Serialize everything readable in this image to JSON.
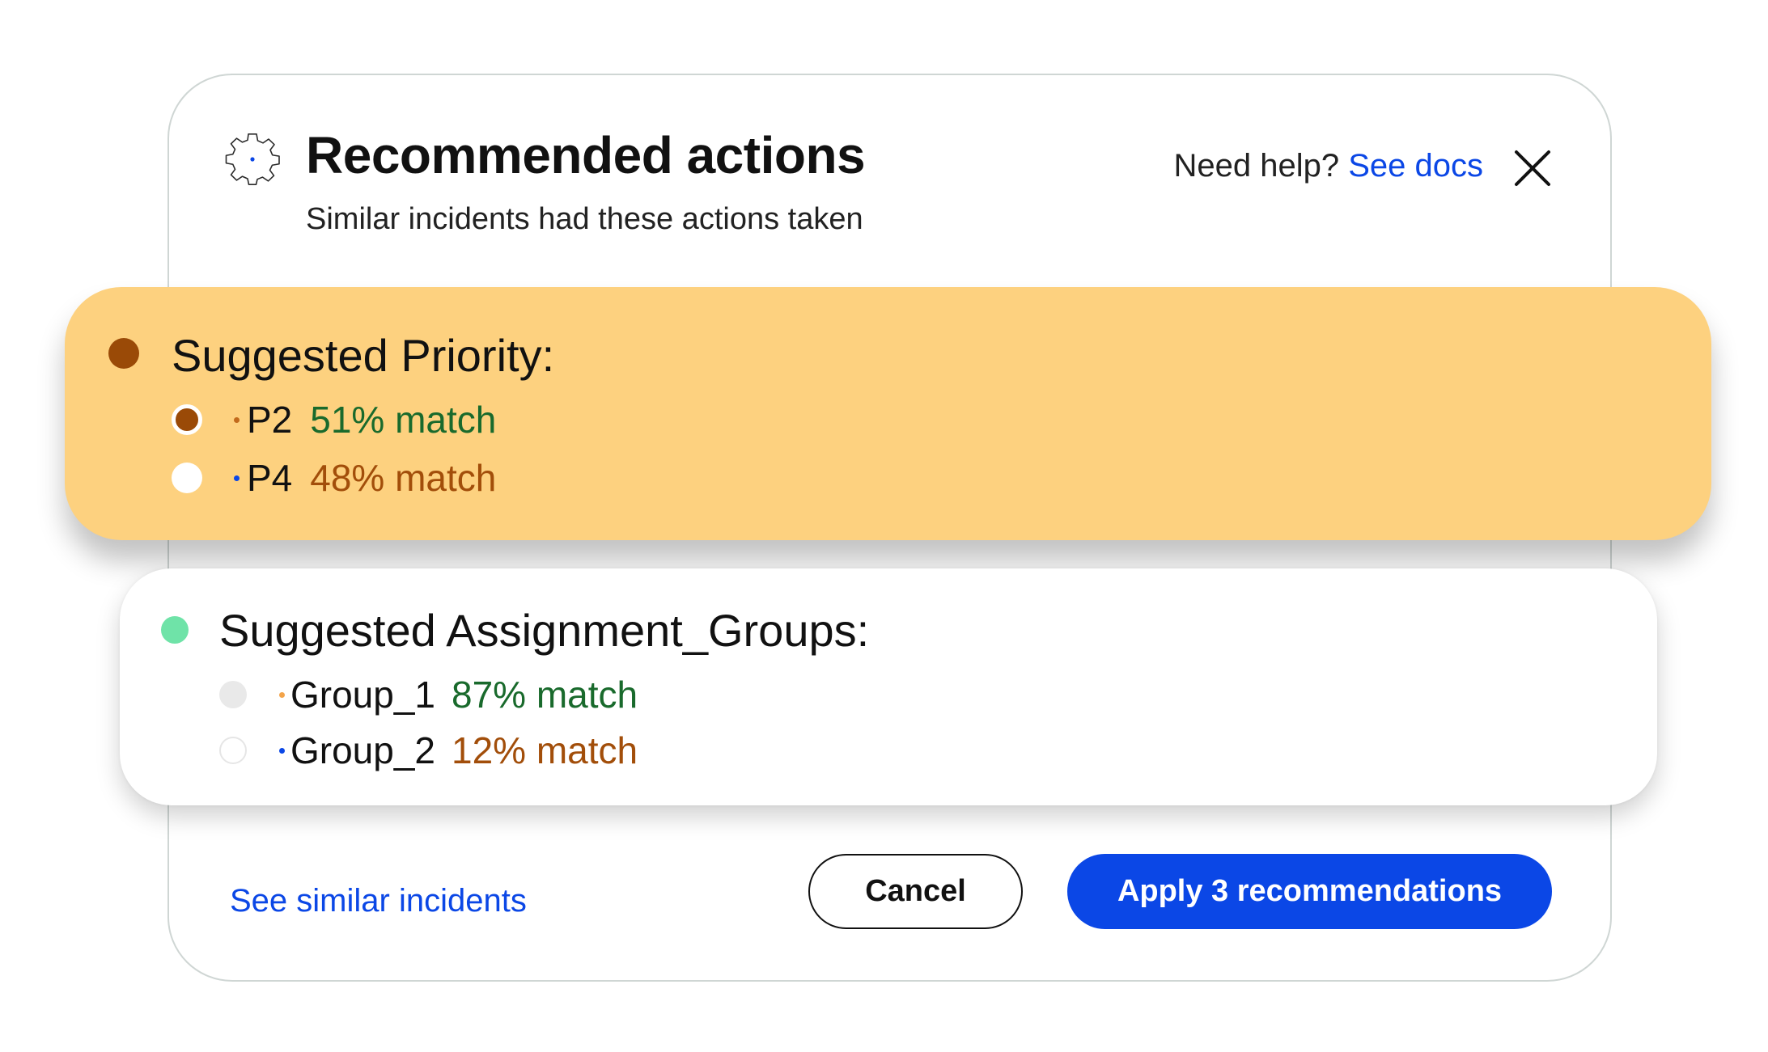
{
  "header": {
    "title": "Recommended actions",
    "subtitle": "Similar incidents had these actions taken",
    "help_prefix": "Need help? ",
    "help_link": "See docs"
  },
  "icons": {
    "header": "gear-icon",
    "close": "close-icon"
  },
  "priority": {
    "title": "Suggested Priority:",
    "background_color": "#fdd17f",
    "status_dot_color": "#9a4a07",
    "options": [
      {
        "label": "P2",
        "match": "51% match",
        "selected": true,
        "bullet_color": "#c26a1c",
        "match_color": "#196a2c"
      },
      {
        "label": "P4",
        "match": "48% match",
        "selected": false,
        "bullet_color": "#0b47e6",
        "match_color": "#a24e0a"
      }
    ]
  },
  "assignment_groups": {
    "title": "Suggested Assignment_Groups:",
    "status_dot_color": "#6fe3a8",
    "options": [
      {
        "label": "Group_1",
        "match": "87% match",
        "selected": false,
        "bullet_color": "#f3a44a",
        "match_color": "#196a2c"
      },
      {
        "label": "Group_2",
        "match": "12% match",
        "selected": false,
        "bullet_color": "#0b47e6",
        "match_color": "#a24e0a"
      }
    ]
  },
  "footer": {
    "similar_link": "See similar incidents",
    "cancel_label": "Cancel",
    "apply_label": "Apply 3 recommendations"
  },
  "colors": {
    "accent": "#0b47e6",
    "match_high": "#196a2c",
    "match_low": "#a24e0a"
  }
}
